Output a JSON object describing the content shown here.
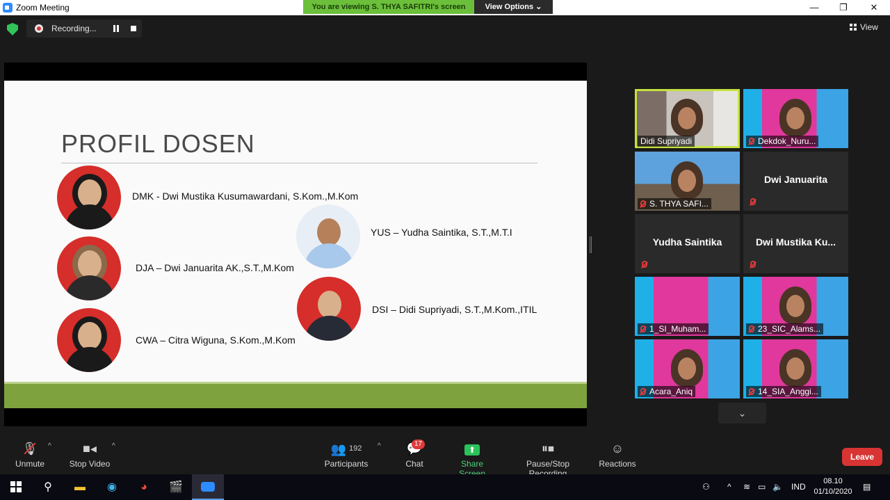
{
  "window": {
    "title": "Zoom Meeting",
    "viewing_banner": "You are viewing S. THYA SAFITRI's screen",
    "view_options": "View Options"
  },
  "topbar": {
    "recording_label": "Recording...",
    "view_label": "View"
  },
  "slide": {
    "heading": "PROFIL DOSEN",
    "lecturers": [
      {
        "text": "DMK - Dwi Mustika Kusumawardani, S.Kom.,M.Kom"
      },
      {
        "text": "DJA – Dwi Januarita AK.,S.T.,M.Kom"
      },
      {
        "text": "CWA – Citra Wiguna, S.Kom.,M.Kom"
      },
      {
        "text": "YUS – Yudha Saintika, S.T.,M.T.I"
      },
      {
        "text": "DSI – Didi Supriyadi, S.T.,M.Kom.,ITIL"
      }
    ]
  },
  "gallery": {
    "tiles": [
      {
        "name": "Didi Supriyadi"
      },
      {
        "name": "Dekdok_Nuru..."
      },
      {
        "name": "S. THYA SAFI..."
      },
      {
        "name": "Dwi Januarita"
      },
      {
        "name": "Yudha Saintika"
      },
      {
        "name": "Dwi  Mustika  Ku..."
      },
      {
        "name": "1_SI_Muham..."
      },
      {
        "name": "23_SIC_Alams..."
      },
      {
        "name": "Acara_Aniq"
      },
      {
        "name": "14_SIA_Anggi..."
      }
    ]
  },
  "toolbar": {
    "unmute": "Unmute",
    "stop_video": "Stop Video",
    "participants": "Participants",
    "participants_count": "192",
    "chat": "Chat",
    "chat_badge": "17",
    "share_screen": "Share Screen",
    "pause_stop_recording": "Pause/Stop Recording",
    "reactions": "Reactions",
    "leave": "Leave"
  },
  "taskbar": {
    "language": "IND",
    "time": "08.10",
    "date": "01/10/2020"
  },
  "colors": {
    "banner_green": "#6bbf3a",
    "active_speaker": "#c5e23f",
    "leave_red": "#d93434",
    "share_green": "#2bc25a"
  }
}
